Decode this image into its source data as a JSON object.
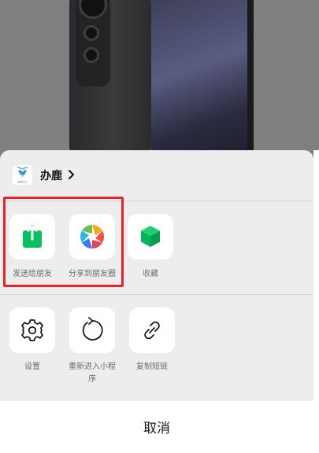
{
  "app": {
    "name": "办鹿",
    "logo_text": "BAN·LU"
  },
  "share_actions": [
    {
      "label": "发送给朋友",
      "icon": "share-upload-icon"
    },
    {
      "label": "分享到朋友圈",
      "icon": "moments-aperture-icon"
    },
    {
      "label": "收藏",
      "icon": "favorite-cube-icon"
    }
  ],
  "system_actions": [
    {
      "label": "设置",
      "icon": "gear-icon"
    },
    {
      "label_line1": "重新进入小程",
      "label_line2": "序",
      "icon": "refresh-icon"
    },
    {
      "label": "复制短链",
      "icon": "link-icon"
    }
  ],
  "cancel_label": "取消",
  "colors": {
    "highlight": "#e5232f",
    "wechat_green": "#07c160",
    "sheet_bg": "#ededed"
  }
}
